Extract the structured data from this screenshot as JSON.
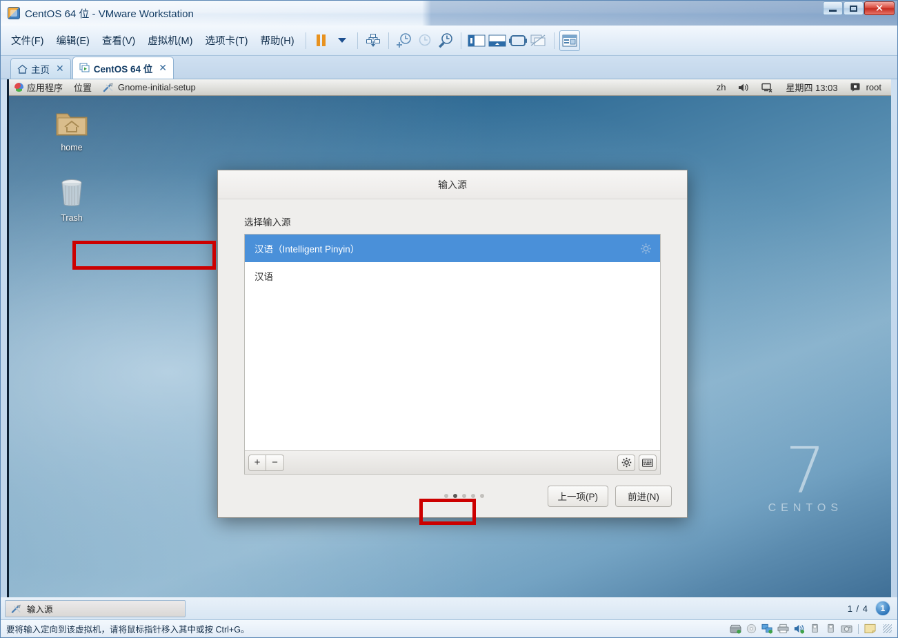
{
  "window": {
    "title": "CentOS 64 位 - VMware Workstation",
    "app_icon": "vmware-icon",
    "minimize": "–",
    "maximize": "□",
    "close": "✕"
  },
  "menubar": {
    "items": [
      {
        "label": "文件(F)",
        "name": "menu-file"
      },
      {
        "label": "编辑(E)",
        "name": "menu-edit"
      },
      {
        "label": "查看(V)",
        "name": "menu-view"
      },
      {
        "label": "虚拟机(M)",
        "name": "menu-vm"
      },
      {
        "label": "选项卡(T)",
        "name": "menu-tabs"
      },
      {
        "label": "帮助(H)",
        "name": "menu-help"
      }
    ]
  },
  "toolbar": {
    "icons": [
      "pause-icon",
      "dropdown-caret-icon",
      "send-ctrl-alt-del-icon",
      "snapshot-take-icon",
      "snapshot-revert-icon",
      "snapshot-manager-icon",
      "show-sidebar-icon",
      "show-console-icon",
      "fullscreen-icon",
      "unity-mode-icon",
      "show-thumbnail-bar-icon"
    ]
  },
  "tabs": [
    {
      "label": "主页",
      "icon": "home-icon",
      "close": "✕",
      "active": false
    },
    {
      "label": "CentOS 64 位",
      "icon": "vm-icon",
      "close": "✕",
      "active": true
    }
  ],
  "gnome_panel": {
    "applications": "应用程序",
    "places": "位置",
    "active_window": "Gnome-initial-setup",
    "active_window_icon": "tools-icon",
    "keyboard_layout": "zh",
    "volume_icon": "volume-icon",
    "network_icon": "network-disconnected-icon",
    "clock": "星期四 13:03",
    "user_icon": "user-icon",
    "user": "root"
  },
  "desktop": {
    "icons": [
      {
        "label": "home",
        "name": "desktop-icon-home"
      },
      {
        "label": "Trash",
        "name": "desktop-icon-trash"
      }
    ],
    "watermark_number": "7",
    "watermark_text": "CENTOS"
  },
  "dialog": {
    "title": "输入源",
    "section_label": "选择输入源",
    "sources": [
      {
        "label": "汉语（Intelligent Pinyin）",
        "selected": true,
        "gear_icon": "gear-icon"
      },
      {
        "label": "汉语",
        "selected": false,
        "gear_icon": ""
      }
    ],
    "list_toolbar": {
      "add": "+",
      "remove": "−",
      "preferences_icon": "gear-icon",
      "keyboard_icon": "keyboard-icon"
    },
    "page_dots": {
      "total": 5,
      "active_index": 1
    },
    "buttons": {
      "previous": "上一项(P)",
      "next": "前进(N)"
    }
  },
  "taskbar": {
    "window_title": "输入源",
    "window_icon": "tools-icon",
    "page_counter": "1 / 4",
    "page_badge": "1"
  },
  "status_bar": {
    "message": "要将输入定向到该虚拟机，请将鼠标指针移入其中或按 Ctrl+G。",
    "device_icons": [
      "hard-disk-icon",
      "cd-dvd-icon",
      "network-adapter-icon",
      "printer-icon",
      "sound-card-icon",
      "usb-device-icon",
      "usb-device-2-icon",
      "camera-icon",
      "note-icon"
    ]
  },
  "colors": {
    "accent_selection": "#4a90d9",
    "annotation": "#cc0000",
    "titlebar_text": "#103a63"
  }
}
